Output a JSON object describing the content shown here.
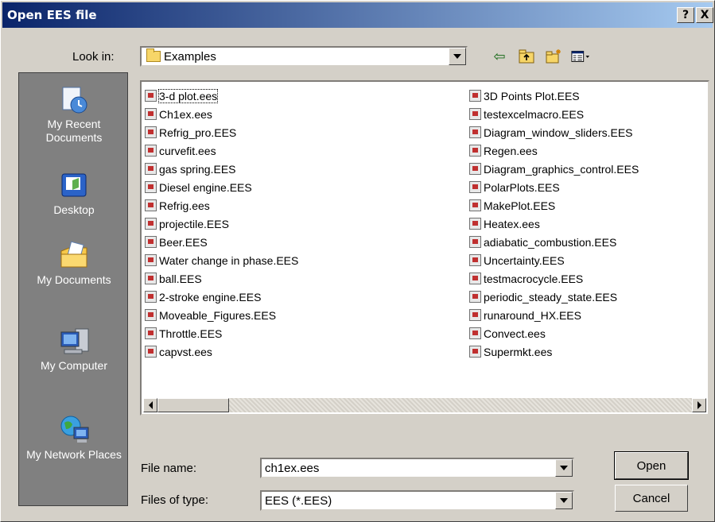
{
  "window": {
    "title": "Open EES file",
    "help_label": "?",
    "close_label": "X"
  },
  "lookin": {
    "label": "Look in:",
    "value": "Examples"
  },
  "places": [
    {
      "label": "My Recent Documents",
      "icon": "recent-documents-icon"
    },
    {
      "label": "Desktop",
      "icon": "desktop-icon"
    },
    {
      "label": "My Documents",
      "icon": "my-documents-icon"
    },
    {
      "label": "My Computer",
      "icon": "my-computer-icon"
    },
    {
      "label": "My Network Places",
      "icon": "network-places-icon"
    }
  ],
  "files_col1": [
    "3-d plot.ees",
    "Ch1ex.ees",
    "Refrig_pro.EES",
    "curvefit.ees",
    "gas spring.EES",
    "Diesel engine.EES",
    "Refrig.ees",
    "projectile.EES",
    "Beer.EES",
    "Water change in phase.EES",
    "ball.EES",
    "2-stroke engine.EES",
    "Moveable_Figures.EES",
    "Throttle.EES",
    "capvst.ees"
  ],
  "files_col2": [
    "3D Points Plot.EES",
    "testexcelmacro.EES",
    "Diagram_window_sliders.EES",
    "Regen.ees",
    "Diagram_graphics_control.EES",
    "PolarPlots.EES",
    "MakePlot.EES",
    "Heatex.ees",
    "adiabatic_combustion.EES",
    "Uncertainty.EES",
    "testmacrocycle.EES",
    "periodic_steady_state.EES",
    "runaround_HX.EES",
    "Convect.ees",
    "Supermkt.ees"
  ],
  "filename": {
    "label": "File name:",
    "value": "ch1ex.ees"
  },
  "filetype": {
    "label": "Files of type:",
    "value": "EES (*.EES)"
  },
  "buttons": {
    "open": "Open",
    "cancel": "Cancel"
  }
}
